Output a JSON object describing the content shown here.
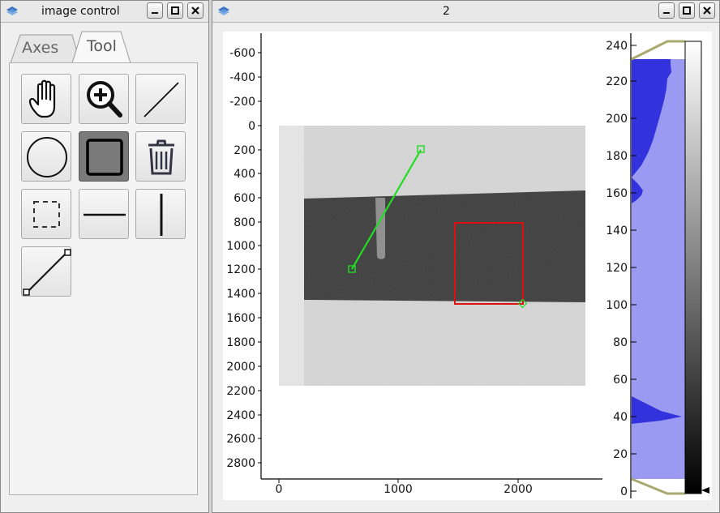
{
  "left_window": {
    "title": "image control",
    "tabs": [
      {
        "label": "Axes",
        "active": false
      },
      {
        "label": "Tool",
        "active": true
      }
    ],
    "tools": [
      {
        "icon": "hand-pan-icon",
        "active": false
      },
      {
        "icon": "zoom-in-icon",
        "active": false
      },
      {
        "icon": "line-draw-icon",
        "active": false
      },
      {
        "icon": "circle-roi-icon",
        "active": false
      },
      {
        "icon": "rectangle-roi-icon",
        "active": true
      },
      {
        "icon": "trash-icon",
        "active": false
      },
      {
        "icon": "dashed-rect-select-icon",
        "active": false
      },
      {
        "icon": "horizontal-line-icon",
        "active": false
      },
      {
        "icon": "vertical-line-icon",
        "active": false
      },
      {
        "icon": "line-profile-icon",
        "active": false
      }
    ]
  },
  "right_window": {
    "title": "2",
    "image_plot": {
      "x_ticks": [
        "0",
        "1000",
        "2000"
      ],
      "y_ticks": [
        "-600",
        "-400",
        "-200",
        "0",
        "200",
        "400",
        "600",
        "800",
        "1000",
        "1200",
        "1400",
        "1600",
        "1800",
        "2000",
        "2200",
        "2400",
        "2600",
        "2800"
      ],
      "line_roi_color": "#22dd22",
      "rect_roi_color": "#dd1111"
    },
    "histogram": {
      "y_ticks": [
        "0",
        "20",
        "40",
        "60",
        "80",
        "100",
        "120",
        "140",
        "160",
        "180",
        "200",
        "220",
        "240"
      ],
      "fill_color": "#9a9af2",
      "profile_color": "#3333dd"
    }
  },
  "colors": {
    "window_bg": "#efefef",
    "active_tool": "#7a7a7a"
  }
}
